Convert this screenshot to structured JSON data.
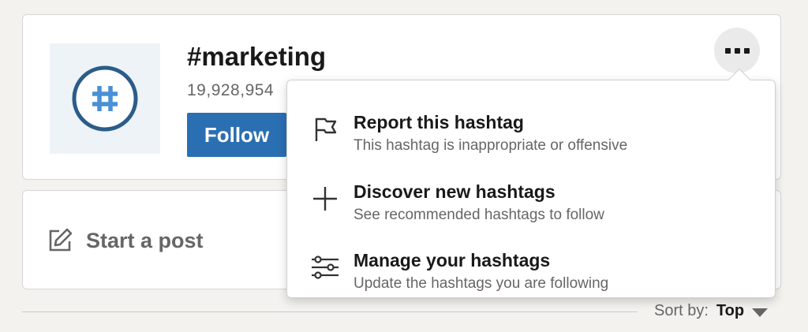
{
  "hashtag": {
    "title": "#marketing",
    "follower_count": "19,928,954",
    "follow_label": "Follow",
    "logo_icon": "hashtag-icon",
    "more_icon": "more-icon"
  },
  "post": {
    "label": "Start a post",
    "icon": "edit-icon"
  },
  "sort": {
    "label": "Sort by:",
    "value": "Top"
  },
  "dropdown": {
    "items": [
      {
        "title": "Report this hashtag",
        "subtitle": "This hashtag is inappropriate or offensive",
        "icon": "flag-icon"
      },
      {
        "title": "Discover new hashtags",
        "subtitle": "See recommended hashtags to follow",
        "icon": "plus-icon"
      },
      {
        "title": "Manage your hashtags",
        "subtitle": "Update the hashtags you are following",
        "icon": "sliders-icon"
      }
    ]
  },
  "colors": {
    "accent": "#2b6fb3",
    "background": "#f3f2ef"
  }
}
